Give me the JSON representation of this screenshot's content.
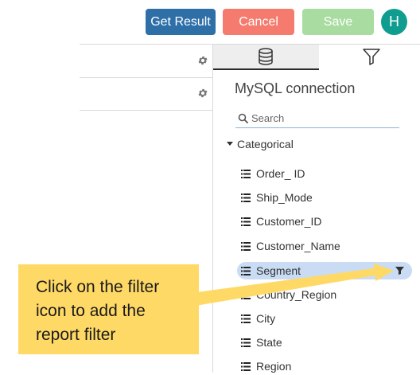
{
  "toolbar": {
    "get_result_label": "Get Result",
    "cancel_label": "Cancel",
    "save_label": "Save",
    "avatar_initial": "H",
    "colors": {
      "get_result": "#2f6fa8",
      "cancel": "#f47b6e",
      "save": "#a9dca0",
      "avatar": "#0e9d8f"
    }
  },
  "left_panel": {
    "row_icons": [
      "gear-icon",
      "gear-icon"
    ]
  },
  "right_panel": {
    "tabs": [
      {
        "icon": "database-icon",
        "active": true
      },
      {
        "icon": "filter-icon",
        "active": false
      }
    ],
    "title": "MySQL connection",
    "search": {
      "icon": "search-icon",
      "placeholder": "Search"
    },
    "category": {
      "label": "Categorical",
      "expanded": true
    },
    "fields": [
      {
        "label": "Order_ ID",
        "selected": false
      },
      {
        "label": "Ship_Mode",
        "selected": false
      },
      {
        "label": "Customer_ID",
        "selected": false
      },
      {
        "label": "Customer_Name",
        "selected": false
      },
      {
        "label": "Segment",
        "selected": true,
        "action_icon": "filter-icon"
      },
      {
        "label": "Country_Region",
        "selected": false
      },
      {
        "label": "City",
        "selected": false
      },
      {
        "label": "State",
        "selected": false
      },
      {
        "label": "Region",
        "selected": false
      }
    ],
    "selected_color": "#c9dcf4"
  },
  "callout": {
    "text": "Click on the filter icon to add the report filter",
    "color": "#ffd966"
  }
}
